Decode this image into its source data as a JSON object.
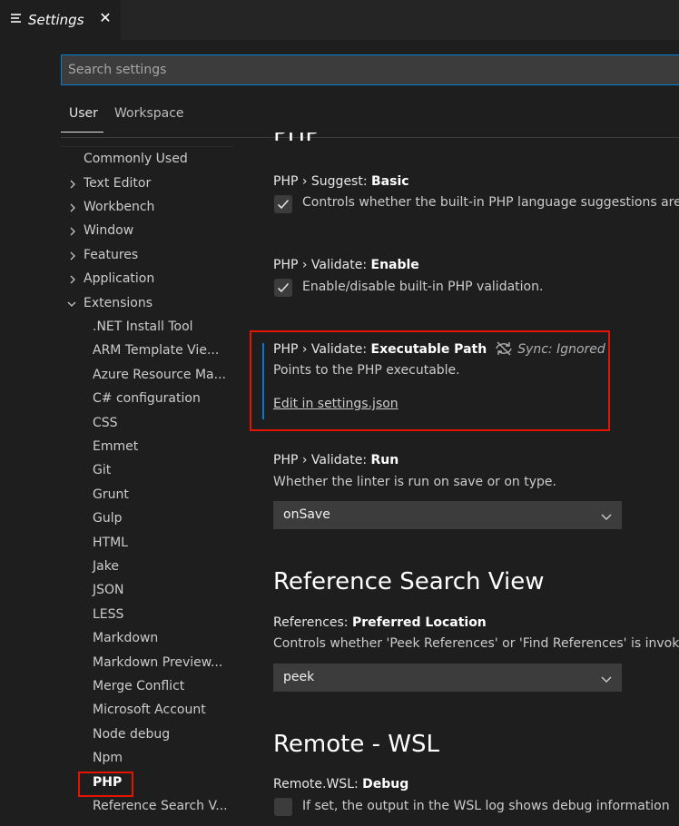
{
  "tab": {
    "title": "Settings",
    "close_glyph": "✕",
    "icon": "settings-list-icon"
  },
  "search": {
    "placeholder": "Search settings",
    "value": ""
  },
  "scope_tabs": {
    "user": "User",
    "workspace": "Workspace"
  },
  "toc": {
    "commonly_used": "Commonly Used",
    "text_editor": "Text Editor",
    "workbench": "Workbench",
    "window": "Window",
    "features": "Features",
    "application": "Application",
    "extensions": "Extensions",
    "ext_items": [
      ".NET Install Tool",
      "ARM Template Vie...",
      "Azure Resource Ma...",
      "C# configuration",
      "CSS",
      "Emmet",
      "Git",
      "Grunt",
      "Gulp",
      "HTML",
      "Jake",
      "JSON",
      "LESS",
      "Markdown",
      "Markdown Preview...",
      "Merge Conflict",
      "Microsoft Account",
      "Node debug",
      "Npm",
      "PHP",
      "Reference Search V..."
    ]
  },
  "settings": {
    "partial_heading": "PHP",
    "suggest": {
      "prefix": "PHP › Suggest: ",
      "name": "Basic",
      "desc": "Controls whether the built-in PHP language suggestions are",
      "checked": true
    },
    "validate_enable": {
      "prefix": "PHP › Validate: ",
      "name": "Enable",
      "desc": "Enable/disable built-in PHP validation.",
      "checked": true
    },
    "validate_path": {
      "prefix": "PHP › Validate: ",
      "name": "Executable Path",
      "sync": "Sync: Ignored",
      "desc": "Points to the PHP executable.",
      "link": "Edit in settings.json"
    },
    "validate_run": {
      "prefix": "PHP › Validate: ",
      "name": "Run",
      "desc": "Whether the linter is run on save or on type.",
      "value": "onSave"
    },
    "ref_section": "Reference Search View",
    "ref_location": {
      "prefix": "References: ",
      "name": "Preferred Location",
      "desc": "Controls whether 'Peek References' or 'Find References' is invoked",
      "value": "peek"
    },
    "wsl_section": "Remote - WSL",
    "wsl_debug": {
      "prefix": "Remote.WSL: ",
      "name": "Debug",
      "desc": "If set, the output in the WSL log shows debug information",
      "checked": false
    }
  },
  "colors": {
    "background": "#1e1e1e",
    "focus_border": "#0078d4",
    "highlight_box": "#e51400"
  }
}
